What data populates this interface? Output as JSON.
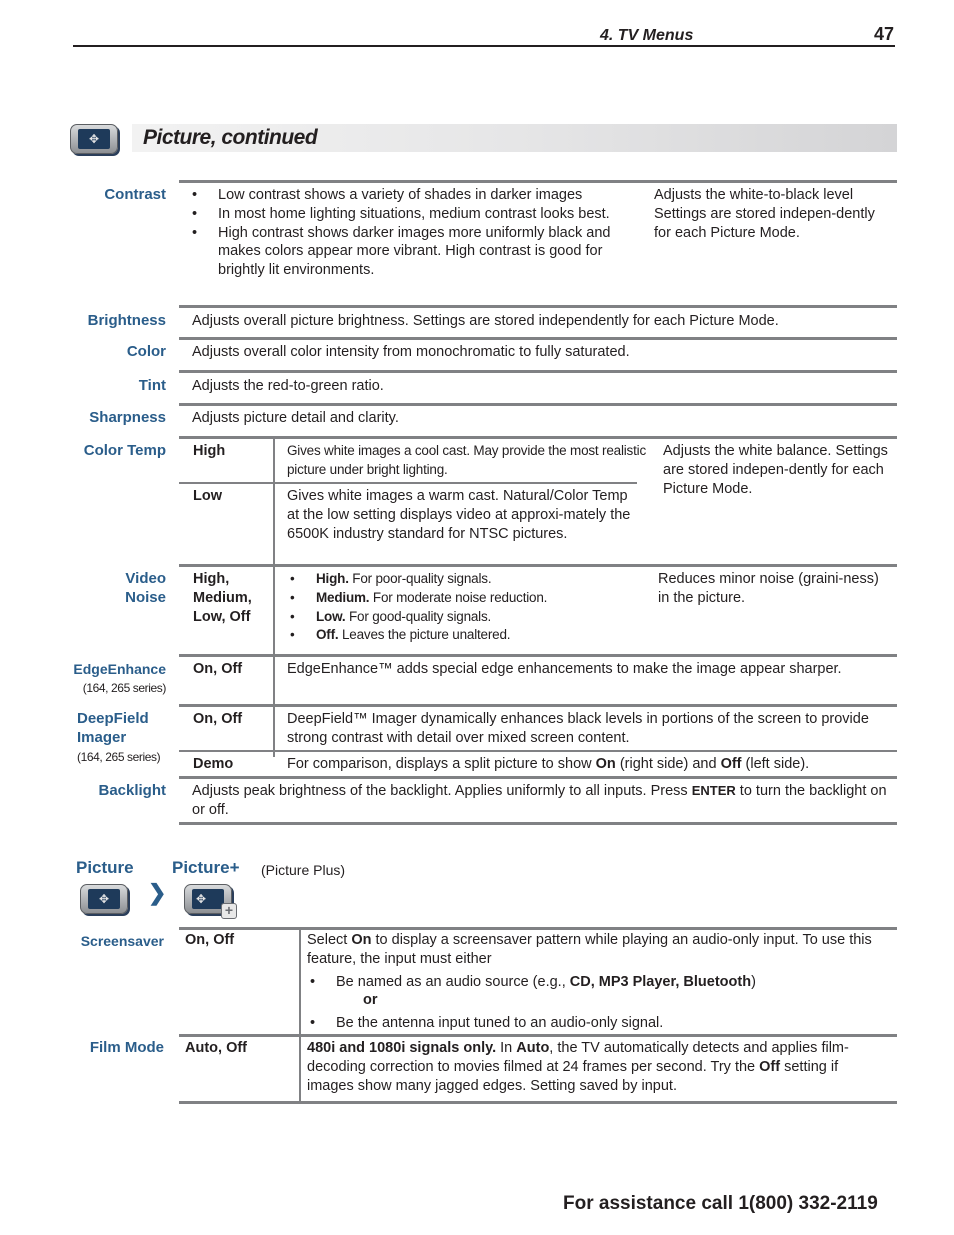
{
  "header": {
    "chapter": "4.  TV Menus",
    "page_number": "47"
  },
  "section": {
    "title": "Picture, continued",
    "icon": "picture-menu-icon"
  },
  "rows": {
    "contrast": {
      "label": "Contrast",
      "bullets": [
        "Low contrast shows a variety of shades in darker images",
        "In most home lighting situations, medium contrast looks best.",
        "High contrast shows darker images more uniformly black and makes colors appear more vibrant.  High contrast is good for brightly lit environments."
      ],
      "note": "Adjusts the white-to-black level Settings are stored indepen-dently for each Picture Mode."
    },
    "brightness": {
      "label": "Brightness",
      "text": "Adjusts overall picture brightness.  Settings are stored independently for each Picture Mode."
    },
    "color": {
      "label": "Color",
      "text": "Adjusts overall color intensity from monochromatic to fully saturated."
    },
    "tint": {
      "label": "Tint",
      "text": "Adjusts the red-to-green ratio."
    },
    "sharpness": {
      "label": "Sharpness",
      "text": "Adjusts picture detail and clarity."
    },
    "color_temp": {
      "label": "Color Temp",
      "options": [
        {
          "name": "High",
          "text": "Gives white images a cool cast.  May provide the most realistic picture under bright lighting."
        },
        {
          "name": "Low",
          "text": "Gives white images a warm cast.  Natural/Color Temp at the low setting displays video at approxi-mately the 6500K industry standard for NTSC pictures."
        }
      ],
      "note": "Adjusts the white balance. Settings are stored indepen-dently for each Picture Mode."
    },
    "video_noise": {
      "label_line1": "Video",
      "label_line2": "Noise",
      "options": "High, Medium, Low, Off",
      "bullets": [
        {
          "bold": "High.",
          "text": "  For poor-quality signals."
        },
        {
          "bold": "Medium.",
          "text": "  For moderate noise reduction."
        },
        {
          "bold": "Low.",
          "text": "  For good-quality signals."
        },
        {
          "bold": "Off.",
          "text": "  Leaves the picture unaltered."
        }
      ],
      "note": "Reduces minor noise (graini-ness) in the picture."
    },
    "edge_enhance": {
      "label": "EdgeEnhance",
      "sublabel": "(164, 265 series)",
      "options": "On, Off",
      "text": "EdgeEnhance™ adds special edge enhancements to make the image appear sharper."
    },
    "deepfield": {
      "label_line1": "DeepField",
      "label_line2": "Imager",
      "sublabel": "(164, 265 series)",
      "options": "On, Off",
      "text": "DeepField™ Imager dynamically enhances black levels in portions of the screen to provide strong contrast with detail over mixed screen content.",
      "demo": {
        "name": "Demo",
        "text_before": "For comparison, displays a split picture to show ",
        "on": "On",
        "text_mid": " (right side) and ",
        "off": "Off",
        "text_after": " (left side)."
      }
    },
    "backlight": {
      "label": "Backlight",
      "text_before": "Adjusts peak brightness of the backlight.  Applies uniformly to all inputs.  Press ",
      "key": "ENTER",
      "text_after": " to turn the backlight on or off."
    }
  },
  "submenu": {
    "path_label_1": "Picture",
    "path_label_2": "Picture+",
    "path_note": "(Picture Plus)",
    "separator": "❯",
    "icons": [
      "picture-menu-icon",
      "picture-plus-menu-icon"
    ]
  },
  "rows2": {
    "screensaver": {
      "label": "Screensaver",
      "options": "On, Off",
      "intro_before": "Select ",
      "intro_bold": "On",
      "intro_after": " to display a screensaver pattern while playing an audio-only input.  To use this feature, the input must either",
      "bullet1_before": "Be named as an audio source (e.g., ",
      "bullet1_bold": "CD, MP3 Player, Bluetooth",
      "bullet1_after": ")",
      "or": "or",
      "bullet2": "Be the antenna input tuned to an audio-only signal."
    },
    "film_mode": {
      "label": "Film Mode",
      "options": "Auto, Off",
      "lead_bold": "480i and 1080i signals only.",
      "t1": "  In ",
      "auto": "Auto",
      "t2": ", the TV automatically detects and applies film-decoding correction to movies filmed at 24 frames per second.  Try the ",
      "off": "Off",
      "t3": " setting if images show many jagged edges.  Setting saved by input."
    }
  },
  "footer": {
    "text": "For assistance call 1(800) 332-2119"
  }
}
